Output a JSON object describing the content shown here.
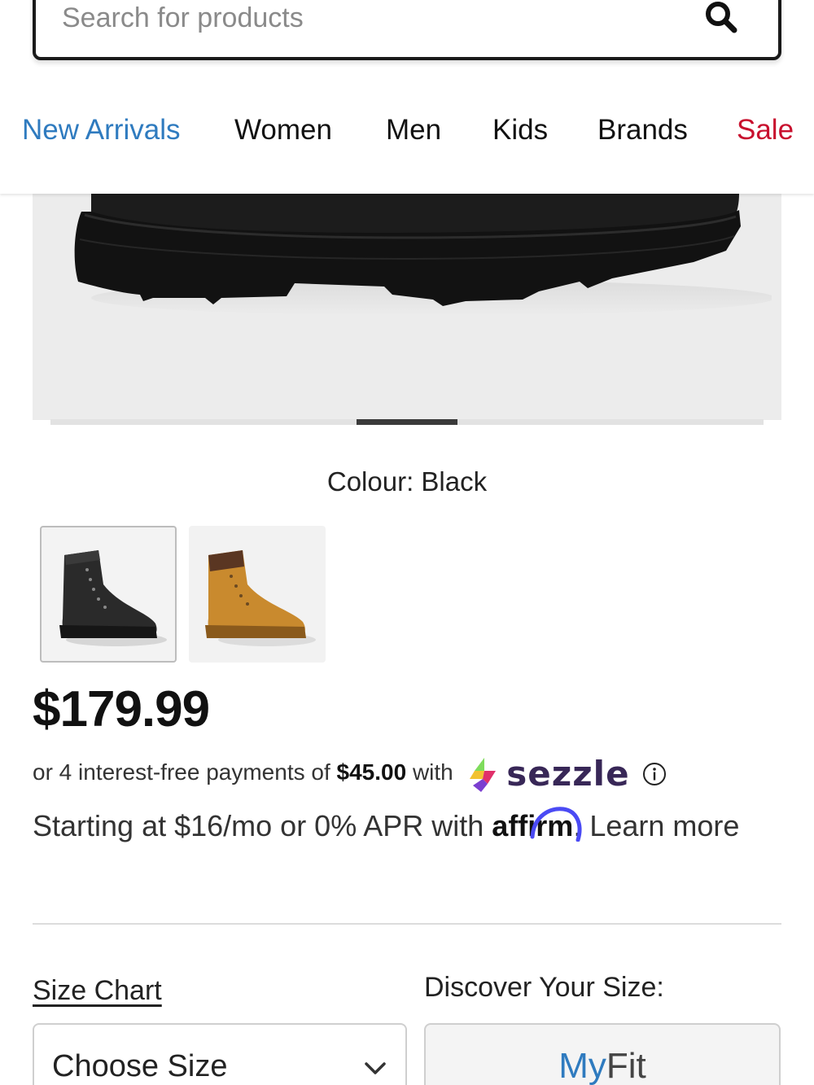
{
  "search": {
    "placeholder": "Search for products",
    "icon": "search-icon"
  },
  "nav": {
    "items": [
      {
        "label": "New Arrivals",
        "color": "#2f7bbf"
      },
      {
        "label": "Women"
      },
      {
        "label": "Men"
      },
      {
        "label": "Kids"
      },
      {
        "label": "Brands"
      },
      {
        "label": "Sale",
        "color": "#c8102e"
      }
    ]
  },
  "gallery": {
    "slide_progress": "3 of 7"
  },
  "product": {
    "colour_label": "Colour: Black",
    "swatches": [
      {
        "name": "Black",
        "selected": true
      },
      {
        "name": "Wheat",
        "selected": false
      }
    ],
    "price": "$179.99"
  },
  "sezzle": {
    "prefix": "or 4 interest-free payments of",
    "amount": "$45.00",
    "suffix": "with",
    "brand": "sezzle",
    "brand_color": "#382757"
  },
  "affirm": {
    "prefix": "Starting at $16/mo or 0% APR with",
    "brand": "affirm",
    "suffix": ". Learn more",
    "arc_color": "#4a4af4"
  },
  "size": {
    "chart_label": "Size Chart",
    "discover_label": "Discover Your Size:",
    "select_label": "Choose Size",
    "myfit_my": "My",
    "myfit_fit": "Fit"
  }
}
